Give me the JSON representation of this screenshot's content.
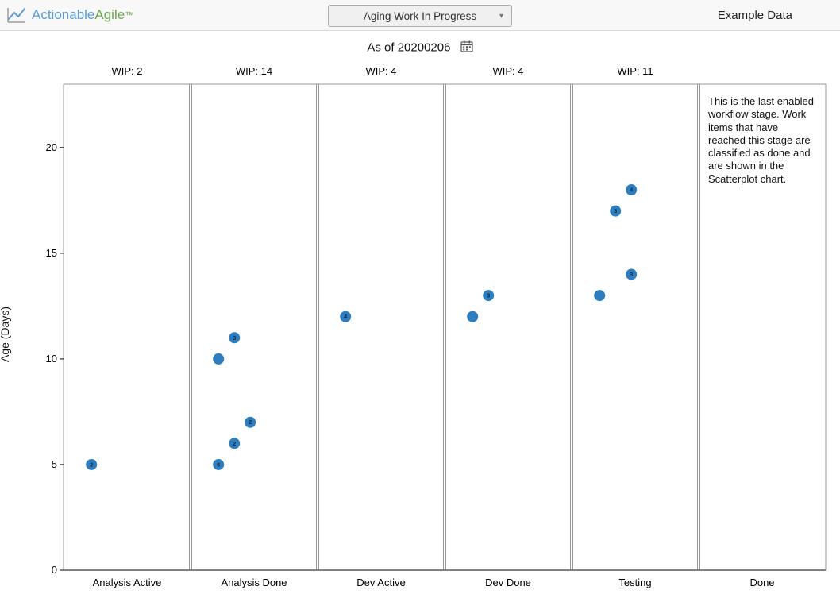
{
  "header": {
    "brand_action": "Actionable",
    "brand_agile": "Agile",
    "brand_tm": "™",
    "chart_selector": "Aging Work In Progress",
    "dataset": "Example Data"
  },
  "asof": {
    "label": "As of 20200206"
  },
  "axis": {
    "ylabel": "Age (Days)",
    "yticks": [
      0,
      5,
      10,
      15,
      20
    ]
  },
  "columns": [
    {
      "name": "Analysis Active",
      "wip": "WIP: 2"
    },
    {
      "name": "Analysis Done",
      "wip": "WIP: 14"
    },
    {
      "name": "Dev Active",
      "wip": "WIP: 4"
    },
    {
      "name": "Dev Done",
      "wip": "WIP: 4"
    },
    {
      "name": "Testing",
      "wip": "WIP: 11"
    },
    {
      "name": "Done",
      "wip": ""
    }
  ],
  "done_note": "This is the last enabled workflow stage. Work items that have reached this stage are classified as done and are shown in the Scatterplot chart.",
  "chart_data": {
    "type": "scatter",
    "ylabel": "Age (Days)",
    "ylim": [
      0,
      23
    ],
    "categories": [
      "Analysis Active",
      "Analysis Done",
      "Dev Active",
      "Dev Done",
      "Testing",
      "Done"
    ],
    "wip_totals": [
      2,
      14,
      4,
      4,
      11,
      null
    ],
    "points": [
      {
        "column": "Analysis Active",
        "age": 5,
        "count": 2,
        "slot": 0
      },
      {
        "column": "Analysis Done",
        "age": 5,
        "count": 6,
        "slot": 0
      },
      {
        "column": "Analysis Done",
        "age": 6,
        "count": 2,
        "slot": 1
      },
      {
        "column": "Analysis Done",
        "age": 7,
        "count": 2,
        "slot": 2
      },
      {
        "column": "Analysis Done",
        "age": 10,
        "count": 1,
        "slot": 0
      },
      {
        "column": "Analysis Done",
        "age": 11,
        "count": 3,
        "slot": 1
      },
      {
        "column": "Dev Active",
        "age": 12,
        "count": 4,
        "slot": 0
      },
      {
        "column": "Dev Done",
        "age": 12,
        "count": 1,
        "slot": 0
      },
      {
        "column": "Dev Done",
        "age": 13,
        "count": 3,
        "slot": 1
      },
      {
        "column": "Testing",
        "age": 13,
        "count": 1,
        "slot": 0
      },
      {
        "column": "Testing",
        "age": 14,
        "count": 3,
        "slot": 2
      },
      {
        "column": "Testing",
        "age": 17,
        "count": 3,
        "slot": 1
      },
      {
        "column": "Testing",
        "age": 18,
        "count": 4,
        "slot": 2
      }
    ],
    "dot_color": "#2d7dbf"
  }
}
